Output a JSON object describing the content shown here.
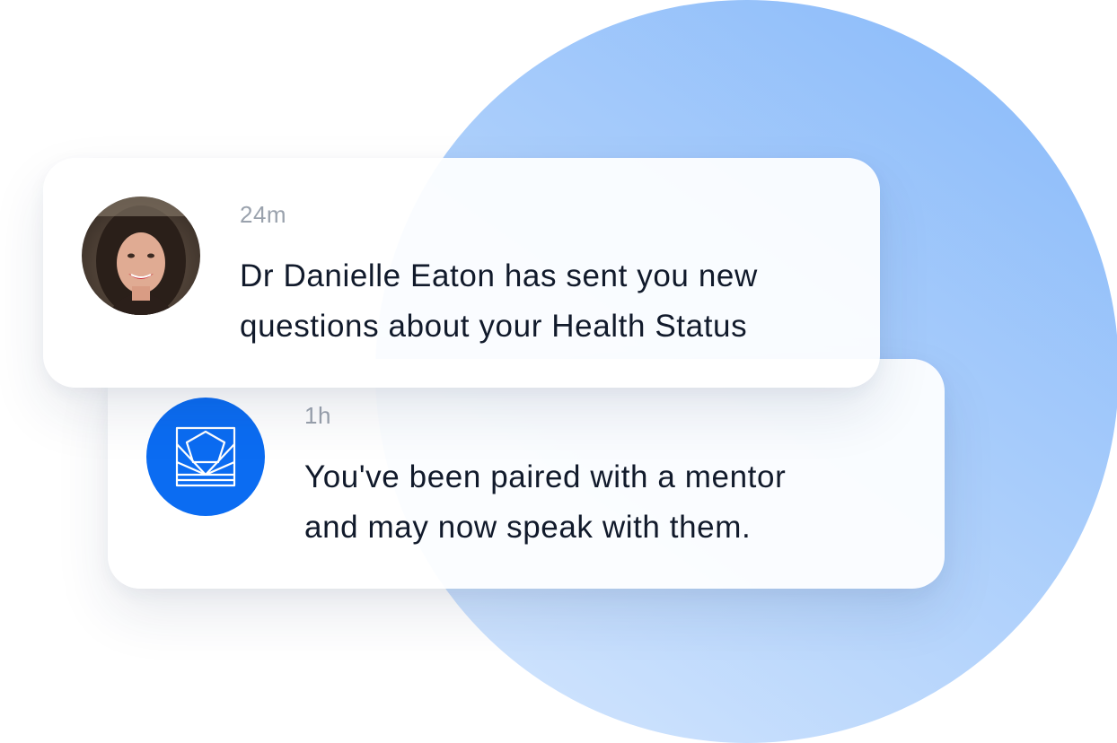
{
  "notifications": [
    {
      "time": "24m",
      "lines": [
        "Dr Danielle Eaton has sent you new",
        "questions about your Health Status"
      ],
      "avatar": "person-photo"
    },
    {
      "time": "1h",
      "lines": [
        "You've been paired with a mentor",
        "and may now speak with them."
      ],
      "avatar": "brand-logo-icon"
    }
  ],
  "colors": {
    "brand_blue": "#0b6cf2",
    "circle_light": "#d7e8fe",
    "circle_dark": "#86b8fa",
    "time_gray": "#9aa2ad",
    "text_dark": "#111a2b"
  }
}
